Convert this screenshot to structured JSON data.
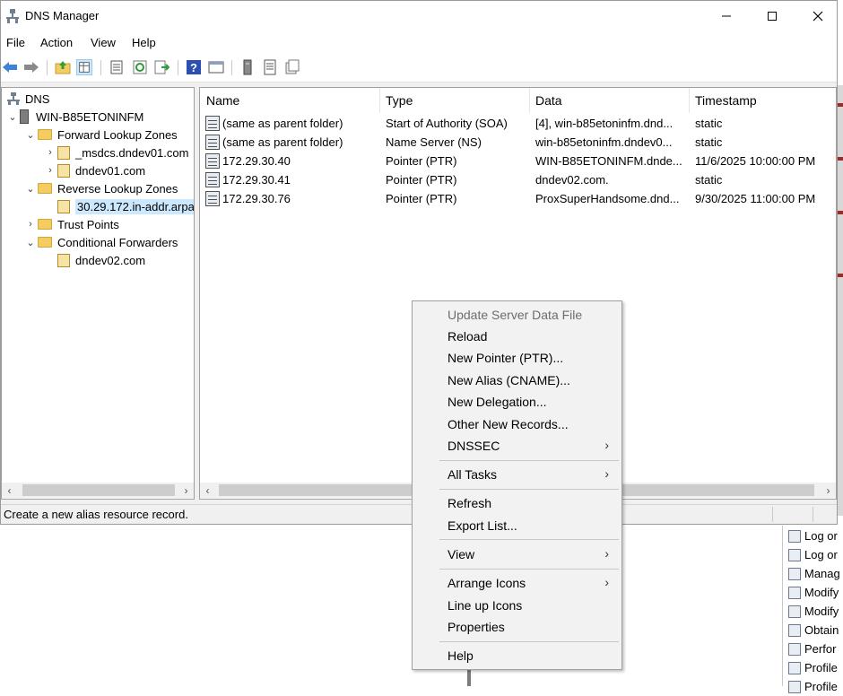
{
  "window": {
    "title": "DNS Manager"
  },
  "menubar": [
    "File",
    "Action",
    "View",
    "Help"
  ],
  "tree": {
    "root": "DNS",
    "server": "WIN-B85ETONINFM",
    "forward_zones_label": "Forward Lookup Zones",
    "forward_zones": [
      "_msdcs.dndev01.com",
      "dndev01.com"
    ],
    "reverse_zones_label": "Reverse Lookup Zones",
    "reverse_zones": [
      "30.29.172.in-addr.arpa"
    ],
    "trust_points": "Trust Points",
    "conditional_forwarders_label": "Conditional Forwarders",
    "conditional_forwarders": [
      "dndev02.com"
    ]
  },
  "list": {
    "columns": [
      "Name",
      "Type",
      "Data",
      "Timestamp"
    ],
    "rows": [
      {
        "name": "(same as parent folder)",
        "type": "Start of Authority (SOA)",
        "data": "[4], win-b85etoninfm.dnd...",
        "timestamp": "static"
      },
      {
        "name": "(same as parent folder)",
        "type": "Name Server (NS)",
        "data": "win-b85etoninfm.dndev0...",
        "timestamp": "static"
      },
      {
        "name": "172.29.30.40",
        "type": "Pointer (PTR)",
        "data": "WIN-B85ETONINFM.dnde...",
        "timestamp": "11/6/2025 10:00:00 PM"
      },
      {
        "name": "172.29.30.41",
        "type": "Pointer (PTR)",
        "data": "dndev02.com.",
        "timestamp": "static"
      },
      {
        "name": "172.29.30.76",
        "type": "Pointer (PTR)",
        "data": "ProxSuperHandsome.dnd...",
        "timestamp": "9/30/2025 11:00:00 PM"
      }
    ]
  },
  "status_text": "Create a new alias resource record.",
  "context_menu": {
    "update_server_data_file": "Update Server Data File",
    "reload": "Reload",
    "new_pointer": "New Pointer (PTR)...",
    "new_alias": "New Alias (CNAME)...",
    "new_delegation": "New Delegation...",
    "other_new_records": "Other New Records...",
    "dnssec": "DNSSEC",
    "all_tasks": "All Tasks",
    "refresh": "Refresh",
    "export_list": "Export List...",
    "view": "View",
    "arrange_icons": "Arrange Icons",
    "line_up_icons": "Line up Icons",
    "properties": "Properties",
    "help": "Help"
  },
  "background_panel": [
    "Log or",
    "Log or",
    "Manag",
    "Modify",
    "Modify",
    "Obtain",
    "Perfor",
    "Profile",
    "Profile"
  ],
  "icons": {
    "toolbar": [
      "back-icon",
      "forward-icon",
      "up-folder-icon",
      "show-hide-tree-icon",
      "properties-icon",
      "refresh-icon",
      "export-list-icon",
      "help-icon",
      "view-icon",
      "server-icon",
      "list-icon",
      "record-icon"
    ]
  },
  "colors": {
    "selection": "#cce8ff",
    "folder": "#f3cd61",
    "arrow_blue": "#3d83d6",
    "disabled_text": "#6d6d6d"
  }
}
